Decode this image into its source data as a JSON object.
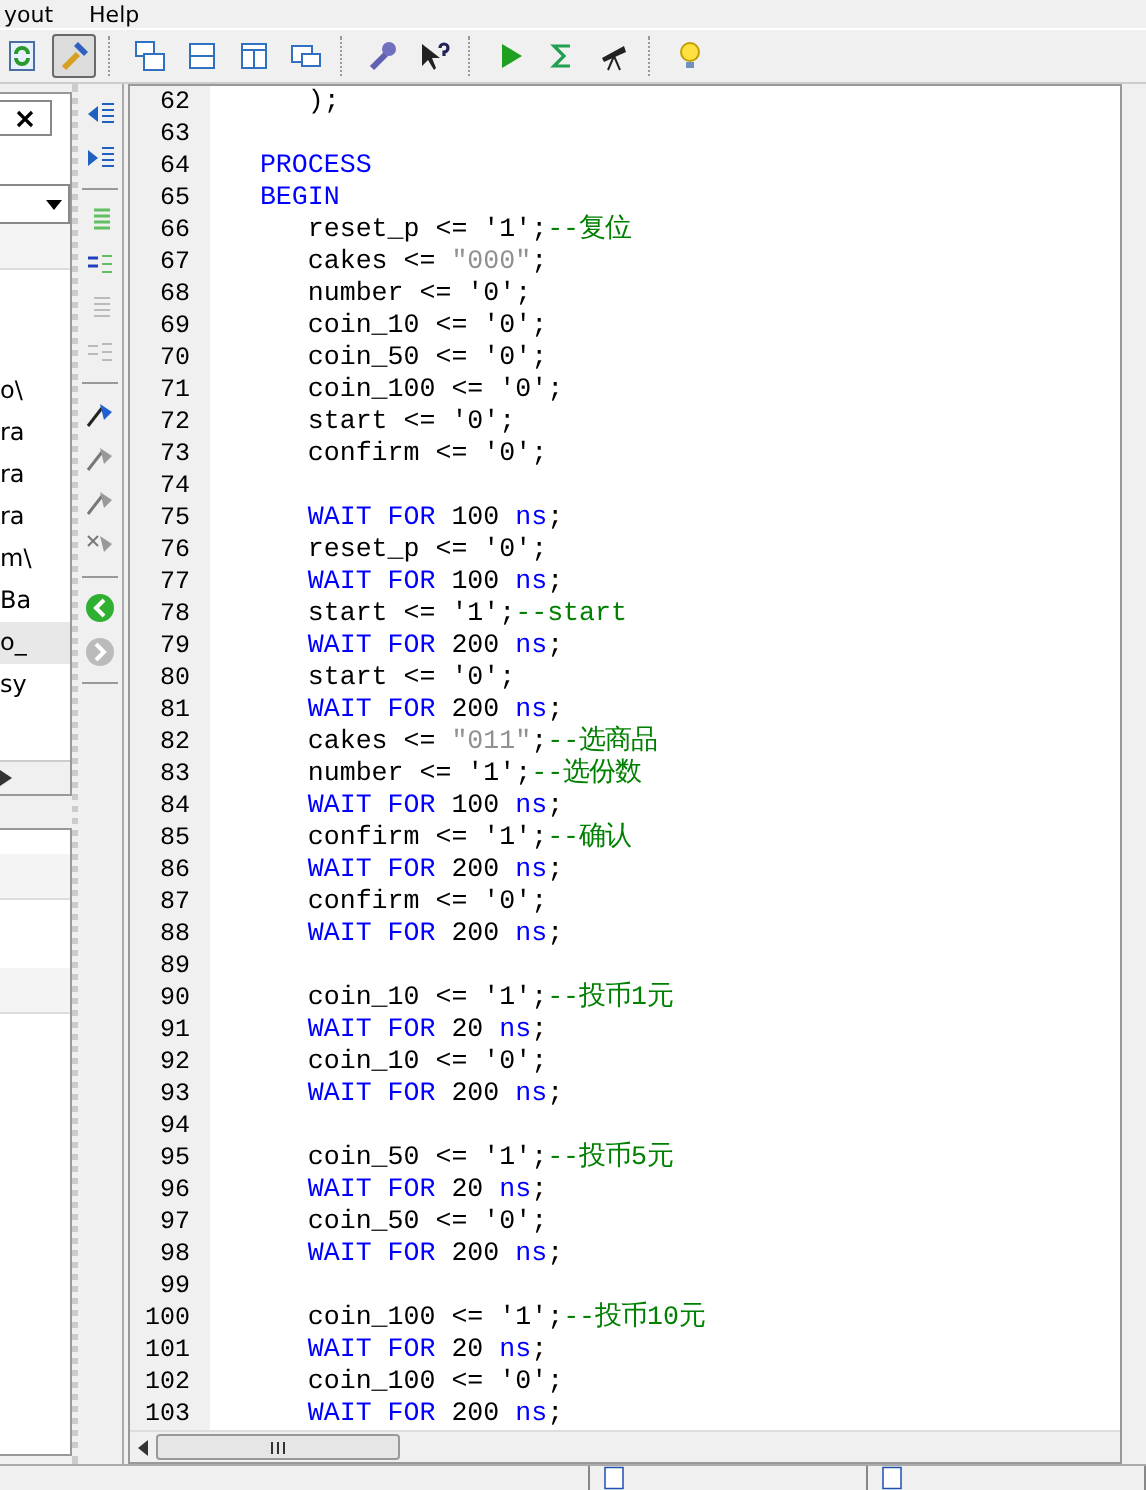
{
  "menu": [
    "yout",
    "Help"
  ],
  "left_panel": {
    "list_fragments": [
      {
        "text": "o\\",
        "selected": false
      },
      {
        "text": "ra",
        "selected": false
      },
      {
        "text": "ra",
        "selected": false
      },
      {
        "text": "ra",
        "selected": false
      },
      {
        "text": "m\\",
        "selected": false
      },
      {
        "text": "Ba",
        "selected": false
      },
      {
        "text": "o_",
        "selected": true
      },
      {
        "text": "sy",
        "selected": false
      }
    ]
  },
  "editor": {
    "lines": [
      {
        "number": "62",
        "parts": [
          {
            "kind": "plain",
            "text": "      );"
          }
        ]
      },
      {
        "number": "63"
      },
      {
        "number": "64",
        "parts": [
          {
            "kind": "kw",
            "text": "   PROCESS"
          }
        ]
      },
      {
        "number": "65",
        "parts": [
          {
            "kind": "kw",
            "text": "   BEGIN"
          }
        ]
      },
      {
        "number": "66",
        "parts": [
          {
            "kind": "plain",
            "text": "      reset_p <= '1';"
          },
          {
            "kind": "comment",
            "text": "--复位"
          }
        ]
      },
      {
        "number": "67",
        "parts": [
          {
            "kind": "plain",
            "text": "      cakes <= "
          },
          {
            "kind": "str",
            "text": "\"000\""
          },
          {
            "kind": "plain",
            "text": ";"
          }
        ]
      },
      {
        "number": "68",
        "parts": [
          {
            "kind": "plain",
            "text": "      number <= '0';"
          }
        ]
      },
      {
        "number": "69",
        "parts": [
          {
            "kind": "plain",
            "text": "      coin_10 <= '0';"
          }
        ]
      },
      {
        "number": "70",
        "parts": [
          {
            "kind": "plain",
            "text": "      coin_50 <= '0';"
          }
        ]
      },
      {
        "number": "71",
        "parts": [
          {
            "kind": "plain",
            "text": "      coin_100 <= '0';"
          }
        ]
      },
      {
        "number": "72",
        "parts": [
          {
            "kind": "plain",
            "text": "      start <= '0';"
          }
        ]
      },
      {
        "number": "73",
        "parts": [
          {
            "kind": "plain",
            "text": "      confirm <= '0';"
          }
        ]
      },
      {
        "number": "74"
      },
      {
        "number": "75",
        "parts": [
          {
            "kind": "kw",
            "text": "      WAIT FOR"
          },
          {
            "kind": "plain",
            "text": " 100 "
          },
          {
            "kind": "kw",
            "text": "ns"
          },
          {
            "kind": "plain",
            "text": ";"
          }
        ]
      },
      {
        "number": "76",
        "parts": [
          {
            "kind": "plain",
            "text": "      reset_p <= '0';"
          }
        ]
      },
      {
        "number": "77",
        "parts": [
          {
            "kind": "kw",
            "text": "      WAIT FOR"
          },
          {
            "kind": "plain",
            "text": " 100 "
          },
          {
            "kind": "kw",
            "text": "ns"
          },
          {
            "kind": "plain",
            "text": ";"
          }
        ]
      },
      {
        "number": "78",
        "parts": [
          {
            "kind": "plain",
            "text": "      start <= '1';"
          },
          {
            "kind": "comment",
            "text": "--start"
          }
        ]
      },
      {
        "number": "79",
        "parts": [
          {
            "kind": "kw",
            "text": "      WAIT FOR"
          },
          {
            "kind": "plain",
            "text": " 200 "
          },
          {
            "kind": "kw",
            "text": "ns"
          },
          {
            "kind": "plain",
            "text": ";"
          }
        ]
      },
      {
        "number": "80",
        "parts": [
          {
            "kind": "plain",
            "text": "      start <= '0';"
          }
        ]
      },
      {
        "number": "81",
        "parts": [
          {
            "kind": "kw",
            "text": "      WAIT FOR"
          },
          {
            "kind": "plain",
            "text": " 200 "
          },
          {
            "kind": "kw",
            "text": "ns"
          },
          {
            "kind": "plain",
            "text": ";"
          }
        ]
      },
      {
        "number": "82",
        "parts": [
          {
            "kind": "plain",
            "text": "      cakes <= "
          },
          {
            "kind": "str",
            "text": "\"011\""
          },
          {
            "kind": "plain",
            "text": ";"
          },
          {
            "kind": "comment",
            "text": "--选商品"
          }
        ]
      },
      {
        "number": "83",
        "parts": [
          {
            "kind": "plain",
            "text": "      number <= '1';"
          },
          {
            "kind": "comment",
            "text": "--选份数"
          }
        ]
      },
      {
        "number": "84",
        "parts": [
          {
            "kind": "kw",
            "text": "      WAIT FOR"
          },
          {
            "kind": "plain",
            "text": " 100 "
          },
          {
            "kind": "kw",
            "text": "ns"
          },
          {
            "kind": "plain",
            "text": ";"
          }
        ]
      },
      {
        "number": "85",
        "parts": [
          {
            "kind": "plain",
            "text": "      confirm <= '1';"
          },
          {
            "kind": "comment",
            "text": "--确认"
          }
        ]
      },
      {
        "number": "86",
        "parts": [
          {
            "kind": "kw",
            "text": "      WAIT FOR"
          },
          {
            "kind": "plain",
            "text": " 200 "
          },
          {
            "kind": "kw",
            "text": "ns"
          },
          {
            "kind": "plain",
            "text": ";"
          }
        ]
      },
      {
        "number": "87",
        "parts": [
          {
            "kind": "plain",
            "text": "      confirm <= '0';"
          }
        ]
      },
      {
        "number": "88",
        "parts": [
          {
            "kind": "kw",
            "text": "      WAIT FOR"
          },
          {
            "kind": "plain",
            "text": " 200 "
          },
          {
            "kind": "kw",
            "text": "ns"
          },
          {
            "kind": "plain",
            "text": ";"
          }
        ]
      },
      {
        "number": "89"
      },
      {
        "number": "90",
        "parts": [
          {
            "kind": "plain",
            "text": "      coin_10 <= '1';"
          },
          {
            "kind": "comment",
            "text": "--投币1元"
          }
        ]
      },
      {
        "number": "91",
        "parts": [
          {
            "kind": "kw",
            "text": "      WAIT FOR"
          },
          {
            "kind": "plain",
            "text": " 20 "
          },
          {
            "kind": "kw",
            "text": "ns"
          },
          {
            "kind": "plain",
            "text": ";"
          }
        ]
      },
      {
        "number": "92",
        "parts": [
          {
            "kind": "plain",
            "text": "      coin_10 <= '0';"
          }
        ]
      },
      {
        "number": "93",
        "parts": [
          {
            "kind": "kw",
            "text": "      WAIT FOR"
          },
          {
            "kind": "plain",
            "text": " 200 "
          },
          {
            "kind": "kw",
            "text": "ns"
          },
          {
            "kind": "plain",
            "text": ";"
          }
        ]
      },
      {
        "number": "94"
      },
      {
        "number": "95",
        "parts": [
          {
            "kind": "plain",
            "text": "      coin_50 <= '1';"
          },
          {
            "kind": "comment",
            "text": "--投币5元"
          }
        ]
      },
      {
        "number": "96",
        "parts": [
          {
            "kind": "kw",
            "text": "      WAIT FOR"
          },
          {
            "kind": "plain",
            "text": " 20 "
          },
          {
            "kind": "kw",
            "text": "ns"
          },
          {
            "kind": "plain",
            "text": ";"
          }
        ]
      },
      {
        "number": "97",
        "parts": [
          {
            "kind": "plain",
            "text": "      coin_50 <= '0';"
          }
        ]
      },
      {
        "number": "98",
        "parts": [
          {
            "kind": "kw",
            "text": "      WAIT FOR"
          },
          {
            "kind": "plain",
            "text": " 200 "
          },
          {
            "kind": "kw",
            "text": "ns"
          },
          {
            "kind": "plain",
            "text": ";"
          }
        ]
      },
      {
        "number": "99"
      },
      {
        "number": "100",
        "parts": [
          {
            "kind": "plain",
            "text": "      coin_100 <= '1';"
          },
          {
            "kind": "comment",
            "text": "--投币10元"
          }
        ]
      },
      {
        "number": "101",
        "parts": [
          {
            "kind": "kw",
            "text": "      WAIT FOR"
          },
          {
            "kind": "plain",
            "text": " 20 "
          },
          {
            "kind": "kw",
            "text": "ns"
          },
          {
            "kind": "plain",
            "text": ";"
          }
        ]
      },
      {
        "number": "102",
        "parts": [
          {
            "kind": "plain",
            "text": "      coin_100 <= '0';"
          }
        ]
      },
      {
        "number": "103",
        "parts": [
          {
            "kind": "kw",
            "text": "      WAIT FOR"
          },
          {
            "kind": "plain",
            "text": " 200 "
          },
          {
            "kind": "kw",
            "text": "ns"
          },
          {
            "kind": "plain",
            "text": ";"
          }
        ]
      }
    ]
  }
}
